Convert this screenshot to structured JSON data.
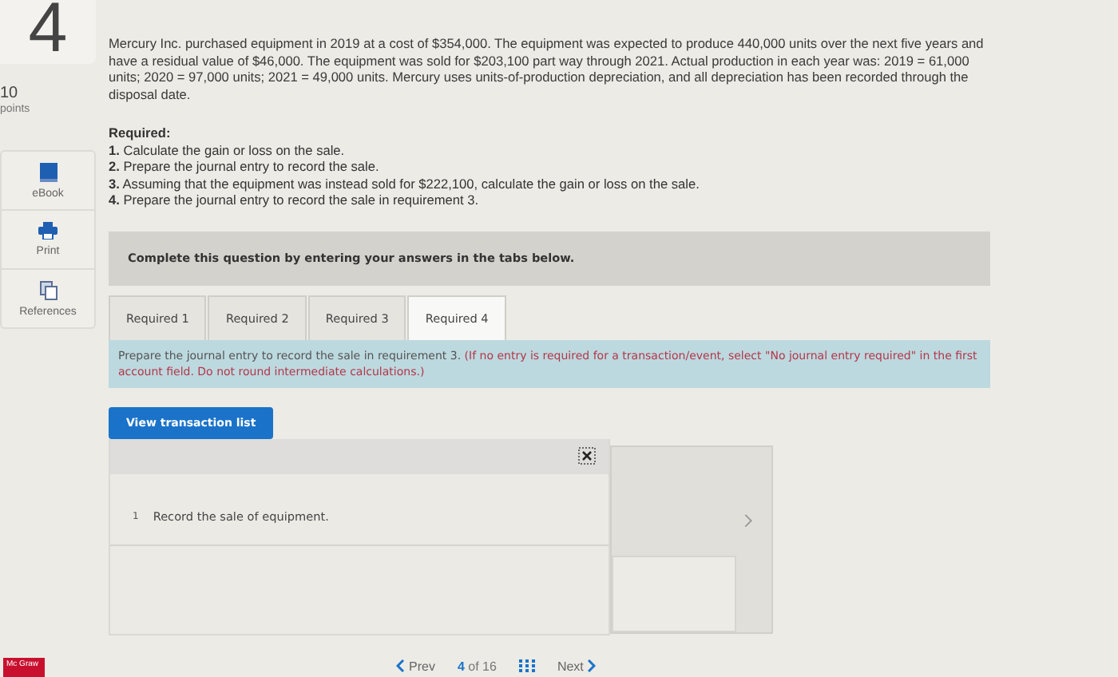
{
  "question": {
    "number": "4",
    "points": "10",
    "points_label": "points"
  },
  "sidebar": {
    "items": [
      {
        "kind": "book",
        "label": "eBook"
      },
      {
        "kind": "print",
        "label": "Print"
      },
      {
        "kind": "references",
        "label": "References"
      }
    ]
  },
  "problem": {
    "text": "Mercury Inc. purchased equipment in 2019 at a cost of $354,000. The equipment was expected to produce 440,000 units over the next five years and have a residual value of $46,000. The equipment was sold for $203,100 part way through 2021. Actual production in each year was: 2019 = 61,000 units; 2020 = 97,000 units; 2021 = 49,000 units. Mercury uses units-of-production depreciation, and all depreciation has been recorded through the disposal date.",
    "required_heading": "Required:",
    "requirements": [
      "**1.** Calculate the gain or loss on the sale.",
      "**2.** Prepare the journal entry to record the sale.",
      "**3.** Assuming that the equipment was instead sold for $222,100, calculate the gain or loss on the sale.",
      "**4.** Prepare the journal entry to record the sale in requirement 3."
    ]
  },
  "banner": "Complete this question by entering your answers in the tabs below.",
  "tabs": [
    {
      "label": "Required 1",
      "selected": false
    },
    {
      "label": "Required 2",
      "selected": false
    },
    {
      "label": "Required 3",
      "selected": false
    },
    {
      "label": "Required 4",
      "selected": true
    }
  ],
  "instruction": {
    "text": "Prepare the journal entry to record the sale in requirement 3.",
    "note": "(If no entry is required for a transaction/event, select \"No journal entry required\" in the first account field. Do not round intermediate calculations.)"
  },
  "view_button": "View transaction list",
  "transactions": [
    {
      "number": "1",
      "description": "Record the sale of equipment."
    }
  ],
  "footer": {
    "brand": "Mc Graw",
    "prev": "Prev",
    "page": "4",
    "page_of": "of 16",
    "next": "Next"
  }
}
